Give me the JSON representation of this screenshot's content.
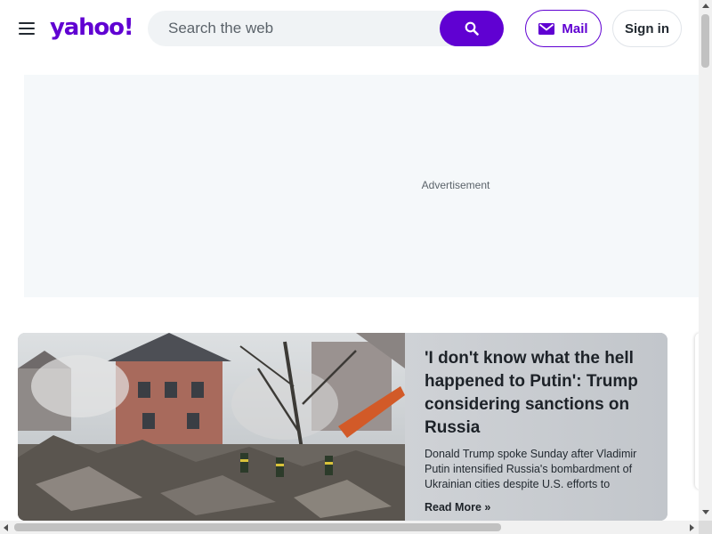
{
  "header": {
    "menu_icon": "hamburger-menu-icon",
    "logo_text": "yahoo!",
    "search": {
      "placeholder": "Search the web",
      "value": "",
      "button_icon": "search-icon"
    },
    "mail": {
      "label": "Mail",
      "icon": "envelope-icon"
    },
    "sign_in": {
      "label": "Sign in"
    }
  },
  "ad": {
    "label": "Advertisement"
  },
  "news_card": {
    "title": "'I don't know what the hell happened to Putin': Trump considering sanctions on Russia",
    "summary": "Donald Trump spoke Sunday after Vladimir Putin intensified Russia's bombardment of Ukrainian cities despite U.S. efforts to broke…",
    "read_more": "Read More »",
    "image": "destroyed-building-rescue-workers-photo"
  },
  "colors": {
    "brand": "#6001d2",
    "text": "#232a31",
    "search_bg": "#f0f3f5",
    "ad_bg": "#f5f8fa"
  }
}
